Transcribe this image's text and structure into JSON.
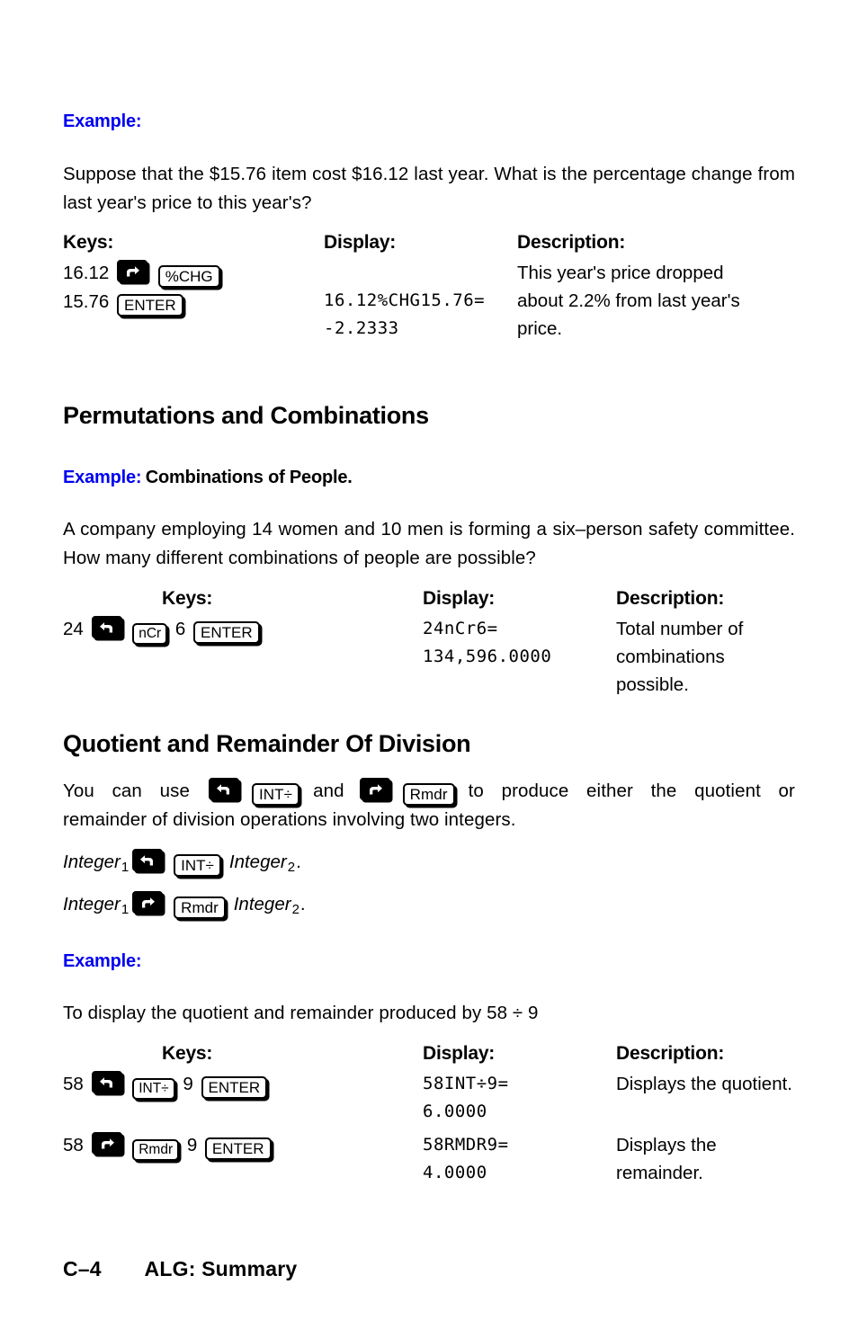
{
  "page": {
    "footer_page_number": "C–4",
    "footer_title": "ALG: Summary"
  },
  "sections": [
    {
      "id": "percent-change",
      "example_label": "Example:",
      "example_subtitle": "",
      "paragraph": "Suppose that the $15.76 item cost $16.12 last year. What is the percentage change from last year's price to this year's?",
      "table": {
        "headers": [
          "Keys:",
          "Display:",
          "Description:"
        ],
        "rows": [
          {
            "keys_line1_prefix": "16.12",
            "keys_line1_keys": [
              "right-shift",
              "%CHG"
            ],
            "keys_line2_prefix": "15.76",
            "keys_line2_keys": [
              "ENTER"
            ],
            "display_lines": [
              "16.12%CHG15.76=",
              "-2.2333"
            ],
            "description": "This year's price dropped about 2.2% from last year's price."
          }
        ]
      }
    },
    {
      "id": "permutations-and-combinations",
      "heading": "Permutations and Combinations",
      "example_label": "Example:",
      "example_subtitle": "Combinations of People.",
      "paragraph": "A company employing 14 women and 10 men is forming a six–person safety committee. How many different combinations of people are possible?",
      "table": {
        "headers": [
          "Keys:",
          "Display:",
          "Description:"
        ],
        "rows": [
          {
            "keys_prefix": "24",
            "keys_mid": "6",
            "display_lines": [
              "24nCr6=",
              "134,596.0000"
            ],
            "description_line1": "Total number of combinations",
            "description_line2": "possible.",
            "key_labels": [
              "left-shift",
              "nCr",
              "ENTER"
            ]
          }
        ]
      }
    },
    {
      "id": "quotient-and-remainder",
      "heading": "Quotient and Remainder Of Division",
      "intro_part1": "You can use",
      "intro_key1_shift": "left-shift",
      "intro_key1": "INT÷",
      "intro_part2": "and",
      "intro_key2_shift": "right-shift",
      "intro_key2": "Rmdr",
      "intro_part3": "to produce either the quotient or remainder of division operations involving two integers.",
      "syntax": [
        {
          "lead": "Integer",
          "sub1": "1",
          "shift": "left-shift",
          "key": "INT÷",
          "trail": "Integer",
          "sub2": "2",
          "period": "."
        },
        {
          "lead": "Integer",
          "sub1": "1",
          "shift": "right-shift",
          "key": "Rmdr",
          "trail": "Integer",
          "sub2": "2",
          "period": "."
        }
      ],
      "example_label": "Example:",
      "paragraph": "To display the quotient and remainder produced by 58 ÷ 9",
      "table": {
        "headers": [
          "Keys:",
          "Display:",
          "Description:"
        ],
        "rows": [
          {
            "keys_prefix": "58",
            "keys_mid": "9",
            "key_shift": "left-shift",
            "key_fn": "INT÷",
            "key_enter": "ENTER",
            "display_lines": [
              "58INT÷9=",
              "6.0000"
            ],
            "description": "Displays the quotient."
          },
          {
            "keys_prefix": "58",
            "keys_mid": "9",
            "key_shift": "right-shift",
            "key_fn": "Rmdr",
            "key_enter": "ENTER",
            "display_lines": [
              "58RMDR9=",
              "4.0000"
            ],
            "description": "Displays the remainder."
          }
        ]
      }
    }
  ],
  "colors": {
    "example_blue": "#0000f0",
    "text_black": "#000000",
    "page_background": "#ffffff"
  }
}
